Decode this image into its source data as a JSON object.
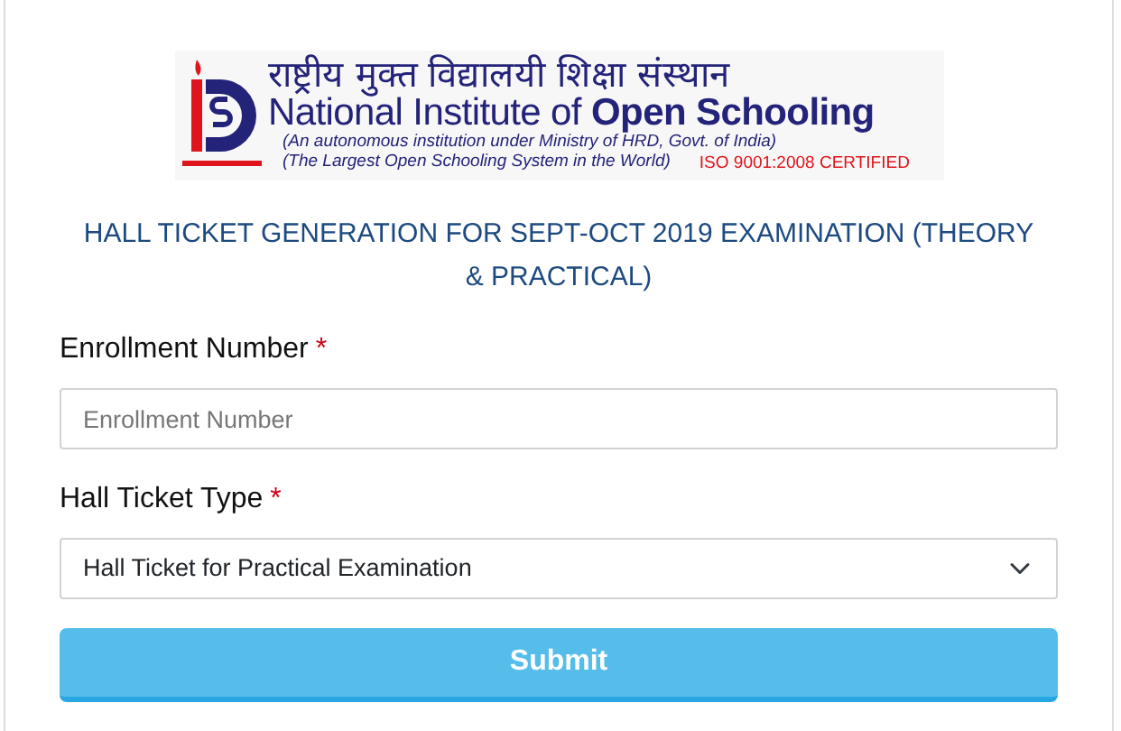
{
  "logo": {
    "hindi": "राष्ट्रीय मुक्त विद्यालयी शिक्षा संस्थान",
    "name": "National Institute of **Open Schooling**",
    "subtitle": "(An autonomous institution under  Ministry of HRD, Govt. of India)",
    "tagline": "(The Largest Open Schooling System in the World)",
    "certification": "ISO 9001:2008 CERTIFIED"
  },
  "title": "HALL TICKET GENERATION FOR SEPT-OCT 2019 EXAMINATION (THEORY & PRACTICAL)",
  "fields": [
    {
      "kind": "text",
      "label": "Enrollment Number",
      "required_mark": "*",
      "placeholder": "Enrollment Number"
    },
    {
      "kind": "select",
      "label": "Hall Ticket Type",
      "required_mark": "*",
      "value": "Hall Ticket for Practical Examination"
    }
  ],
  "submit": "Submit"
}
